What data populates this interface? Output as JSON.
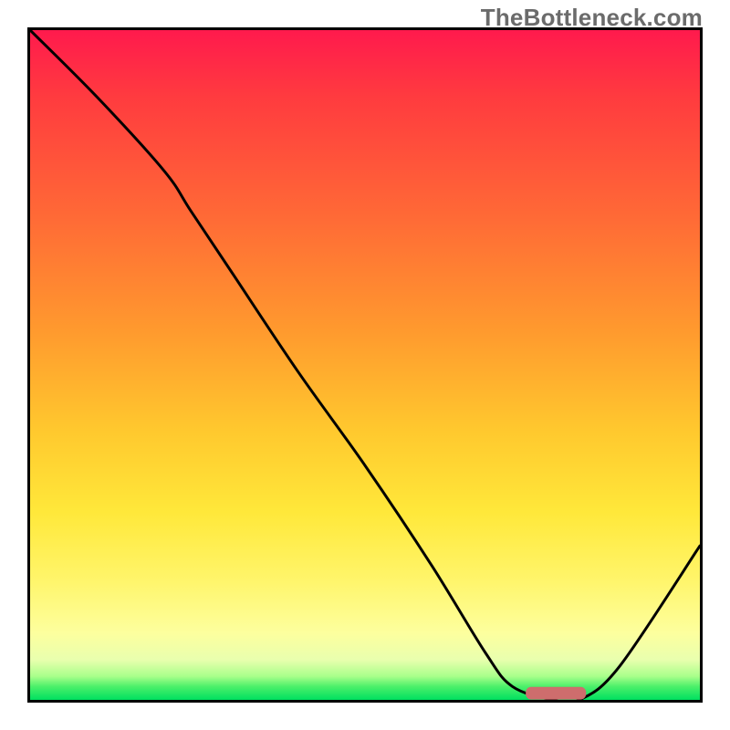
{
  "brand": "TheBottleneck.com",
  "chart_data": {
    "type": "line",
    "title": "",
    "xlabel": "",
    "ylabel": "",
    "xlim": [
      0,
      100
    ],
    "ylim": [
      0,
      100
    ],
    "series": [
      {
        "name": "bottleneck-curve",
        "x": [
          0,
          10,
          20,
          24,
          30,
          40,
          50,
          60,
          68,
          72,
          78,
          82,
          88,
          100
        ],
        "y": [
          100,
          90,
          79,
          73,
          64,
          49,
          35,
          20,
          7,
          2,
          0,
          0,
          5,
          23
        ]
      }
    ],
    "marker": {
      "name": "optimal-range",
      "x_start": 74,
      "x_end": 83,
      "y": 1,
      "color": "#ce6d6d"
    },
    "background_gradient": {
      "stops": [
        {
          "pos": 0,
          "color": "#ff1a4d"
        },
        {
          "pos": 0.1,
          "color": "#ff3b3f"
        },
        {
          "pos": 0.28,
          "color": "#ff6a36"
        },
        {
          "pos": 0.45,
          "color": "#ff9a2e"
        },
        {
          "pos": 0.6,
          "color": "#ffc92e"
        },
        {
          "pos": 0.72,
          "color": "#ffe83a"
        },
        {
          "pos": 0.82,
          "color": "#fff56a"
        },
        {
          "pos": 0.9,
          "color": "#fdff9e"
        },
        {
          "pos": 0.94,
          "color": "#e9ffae"
        },
        {
          "pos": 0.965,
          "color": "#a8ff8a"
        },
        {
          "pos": 0.98,
          "color": "#4cf06a"
        },
        {
          "pos": 1.0,
          "color": "#00e060"
        }
      ]
    }
  }
}
